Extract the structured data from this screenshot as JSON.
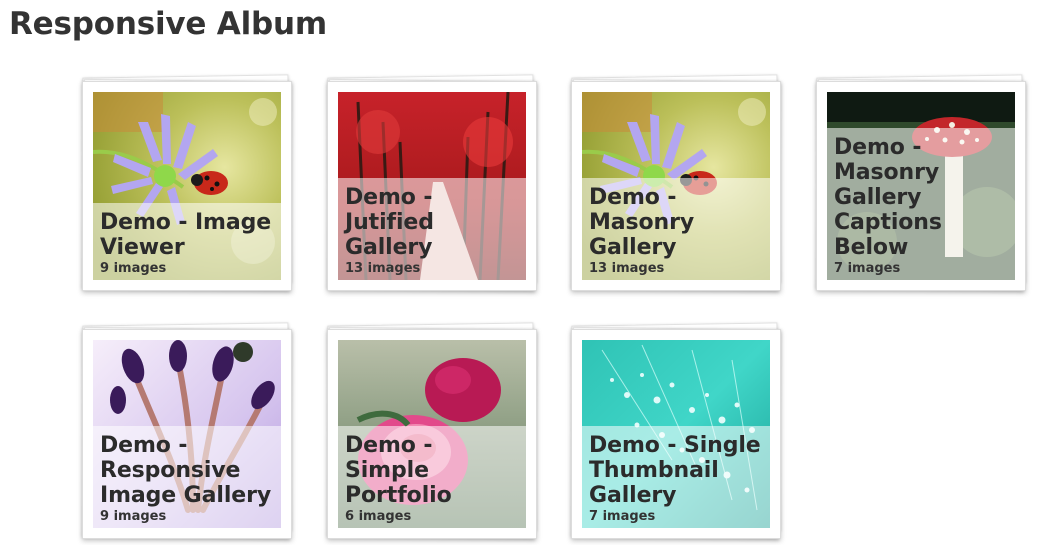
{
  "page": {
    "title": "Responsive Album"
  },
  "albums": [
    {
      "title": "Demo - Image Viewer",
      "count": "9 images",
      "thumbnail": "ladybug-flower-photo"
    },
    {
      "title": "Demo - Jutified Gallery",
      "count": "13 images",
      "thumbnail": "red-tree-avenue-photo"
    },
    {
      "title": "Demo - Masonry Gallery",
      "count": "13 images",
      "thumbnail": "ladybug-flower-photo"
    },
    {
      "title": "Demo - Masonry Gallery Captions Below",
      "count": "7 images",
      "thumbnail": "red-mushroom-photo"
    },
    {
      "title": "Demo - Responsive Image Gallery",
      "count": "9 images",
      "thumbnail": "purple-lily-photo"
    },
    {
      "title": "Demo - Simple Portfolio",
      "count": "6 images",
      "thumbnail": "pink-rose-photo"
    },
    {
      "title": "Demo - Single Thumbnail Gallery",
      "count": "7 images",
      "thumbnail": "dandelion-dew-photo"
    }
  ]
}
